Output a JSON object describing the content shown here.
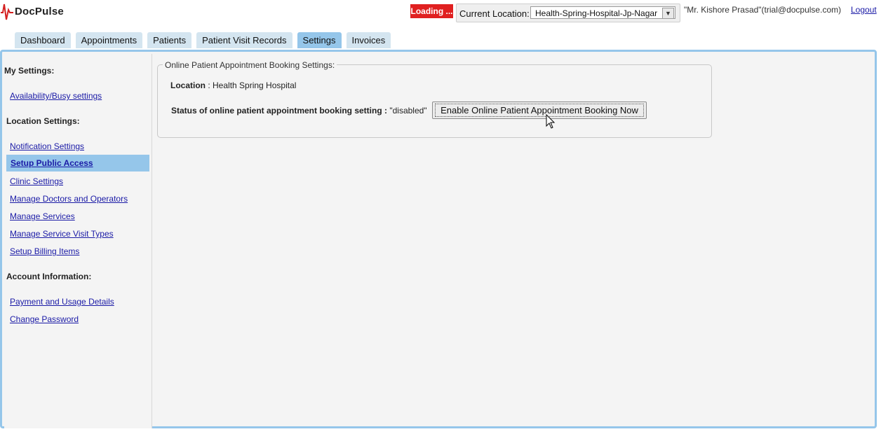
{
  "header": {
    "logo_text": "DocPulse",
    "loading_label": "Loading ...",
    "location_label": "Current Location:",
    "location_value": "Health-Spring-Hospital-Jp-Nagar",
    "user_info": "\"Mr. Kishore Prasad\"(trial@docpulse.com)",
    "logout_label": "Logout"
  },
  "tabs": [
    {
      "label": "Dashboard"
    },
    {
      "label": "Appointments"
    },
    {
      "label": "Patients"
    },
    {
      "label": "Patient Visit Records"
    },
    {
      "label": "Settings"
    },
    {
      "label": "Invoices"
    }
  ],
  "sidebar": {
    "my_settings_heading": "My Settings:",
    "availability_link": "Availability/Busy settings",
    "location_settings_heading": "Location Settings:",
    "location_links": [
      "Notification Settings",
      "Setup Public Access",
      "Clinic Settings",
      "Manage Doctors and Operators",
      "Manage Services",
      "Manage Service Visit Types",
      "Setup Billing Items"
    ],
    "account_heading": "Account Information:",
    "account_links": [
      "Payment and Usage Details",
      "Change Password"
    ]
  },
  "main": {
    "fieldset_title": "Online Patient Appointment Booking Settings:",
    "location_label": "Location",
    "location_sep": " : ",
    "location_value": "Health Spring Hospital",
    "status_label": "Status of online patient appointment booking setting :",
    "status_value": "\"disabled\"",
    "enable_button": "Enable Online Patient Appointment Booking Now"
  },
  "colors": {
    "accent": "#95c6ea",
    "tab_bg": "#d4e5f0",
    "loading_bg": "#e02020",
    "link": "#1a1aa6"
  }
}
